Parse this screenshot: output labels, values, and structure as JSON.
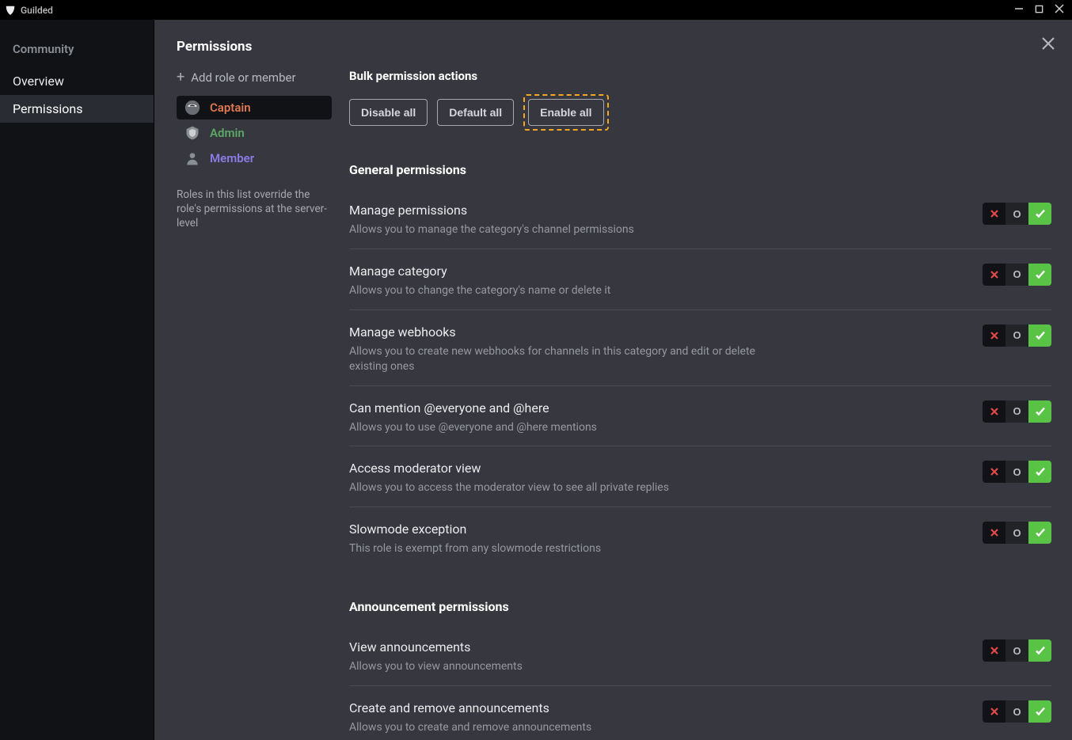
{
  "app": {
    "name": "Guilded"
  },
  "sidebar": {
    "section_label": "Community",
    "items": [
      {
        "label": "Overview"
      },
      {
        "label": "Permissions"
      }
    ]
  },
  "page": {
    "title": "Permissions",
    "add_role_label": "Add role or member",
    "roles": [
      {
        "name": "Captain"
      },
      {
        "name": "Admin"
      },
      {
        "name": "Member"
      }
    ],
    "role_note": "Roles in this list override the role's permissions at the server-level"
  },
  "bulk": {
    "title": "Bulk permission actions",
    "disable": "Disable all",
    "default": "Default all",
    "enable": "Enable all"
  },
  "sections": [
    {
      "title": "General permissions",
      "perms": [
        {
          "name": "Manage permissions",
          "desc": "Allows you to manage the category's channel permissions",
          "state": "allow"
        },
        {
          "name": "Manage category",
          "desc": "Allows you to change the category's name or delete it",
          "state": "allow"
        },
        {
          "name": "Manage webhooks",
          "desc": "Allows you to create new webhooks for channels in this category and edit or delete existing ones",
          "state": "allow"
        },
        {
          "name": "Can mention @everyone and @here",
          "desc": "Allows you to use @everyone and @here mentions",
          "state": "allow"
        },
        {
          "name": "Access moderator view",
          "desc": "Allows you to access the moderator view to see all private replies",
          "state": "allow"
        },
        {
          "name": "Slowmode exception",
          "desc": "This role is exempt from any slowmode restrictions",
          "state": "allow"
        }
      ]
    },
    {
      "title": "Announcement permissions",
      "perms": [
        {
          "name": "View announcements",
          "desc": "Allows you to view announcements",
          "state": "allow"
        },
        {
          "name": "Create and remove announcements",
          "desc": "Allows you to create and remove announcements",
          "state": "allow"
        }
      ]
    }
  ]
}
